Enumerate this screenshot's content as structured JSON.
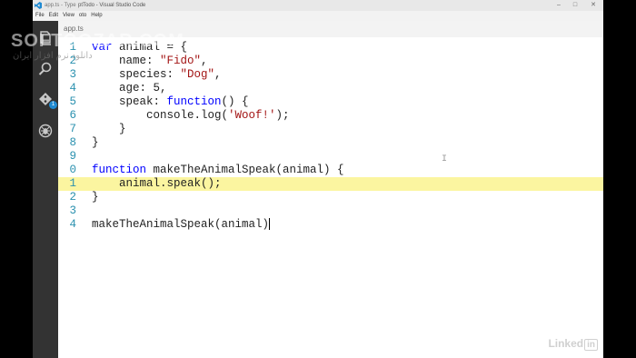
{
  "titlebar": {
    "tab_title": "app.ts - Type",
    "window_title": "ptTodo - Visual Studio Code",
    "minimize": "–",
    "maximize": "□",
    "close": "✕"
  },
  "menu": [
    "File",
    "Edit",
    "View",
    "oto",
    "Help"
  ],
  "activity": {
    "badge_count": "1"
  },
  "editor": {
    "active_tab": "app.ts"
  },
  "code_lines": [
    {
      "num": "1",
      "segments": [
        {
          "t": "var",
          "c": "kw"
        },
        {
          "t": " animal = {"
        }
      ]
    },
    {
      "num": "2",
      "segments": [
        {
          "t": "    name: "
        },
        {
          "t": "\"Fido\"",
          "c": "str"
        },
        {
          "t": ","
        }
      ]
    },
    {
      "num": "3",
      "segments": [
        {
          "t": "    species: "
        },
        {
          "t": "\"Dog\"",
          "c": "str"
        },
        {
          "t": ","
        }
      ]
    },
    {
      "num": "4",
      "segments": [
        {
          "t": "    age: 5,"
        }
      ]
    },
    {
      "num": "5",
      "segments": [
        {
          "t": "    speak: "
        },
        {
          "t": "function",
          "c": "kw"
        },
        {
          "t": "() {"
        }
      ]
    },
    {
      "num": "6",
      "segments": [
        {
          "t": "        console.log("
        },
        {
          "t": "'Woof!'",
          "c": "str"
        },
        {
          "t": ");"
        }
      ]
    },
    {
      "num": "7",
      "segments": [
        {
          "t": "    }"
        }
      ]
    },
    {
      "num": "8",
      "segments": [
        {
          "t": "}"
        }
      ]
    },
    {
      "num": "9",
      "segments": []
    },
    {
      "num": "0",
      "segments": [
        {
          "t": "function",
          "c": "kw"
        },
        {
          "t": " makeTheAnimalSpeak(animal) {"
        }
      ]
    },
    {
      "num": "1",
      "segments": [
        {
          "t": "    animal.speak();"
        }
      ],
      "highlight": true
    },
    {
      "num": "2",
      "segments": [
        {
          "t": "}"
        }
      ]
    },
    {
      "num": "3",
      "segments": []
    },
    {
      "num": "4",
      "segments": [
        {
          "t": "makeTheAnimalSpeak(animal)"
        }
      ],
      "caret": true
    }
  ],
  "watermark": {
    "main": "SOFTGOZAR.COM",
    "sub": "دانلود نرم افزار ایران"
  },
  "linkedin": {
    "text": "Linked",
    "in": "in"
  }
}
